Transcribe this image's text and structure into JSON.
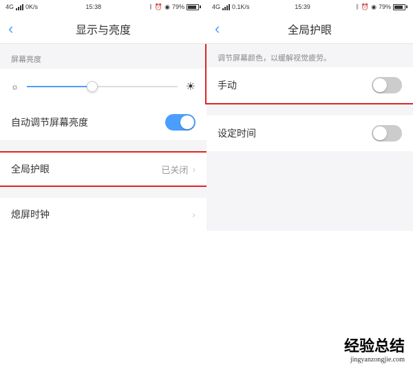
{
  "left": {
    "status": {
      "net": "4G",
      "speed": "0K/s",
      "time": "15:38",
      "battery": "79%"
    },
    "header": {
      "title": "显示与亮度"
    },
    "brightness_label": "屏幕亮度",
    "auto_brightness": "自动调节屏幕亮度",
    "eye_care": {
      "label": "全局护眼",
      "value": "已关闭"
    },
    "standby_clock": "熄屏时钟"
  },
  "right": {
    "status": {
      "net": "4G",
      "speed": "0.1K/s",
      "time": "15:39",
      "battery": "79%"
    },
    "header": {
      "title": "全局护眼"
    },
    "desc": "调节屏幕颜色，以缓解视觉疲劳。",
    "manual": "手动",
    "schedule": "设定时间"
  },
  "watermark": {
    "cn": "经验总结",
    "en": "jingyanzongjie.com"
  }
}
